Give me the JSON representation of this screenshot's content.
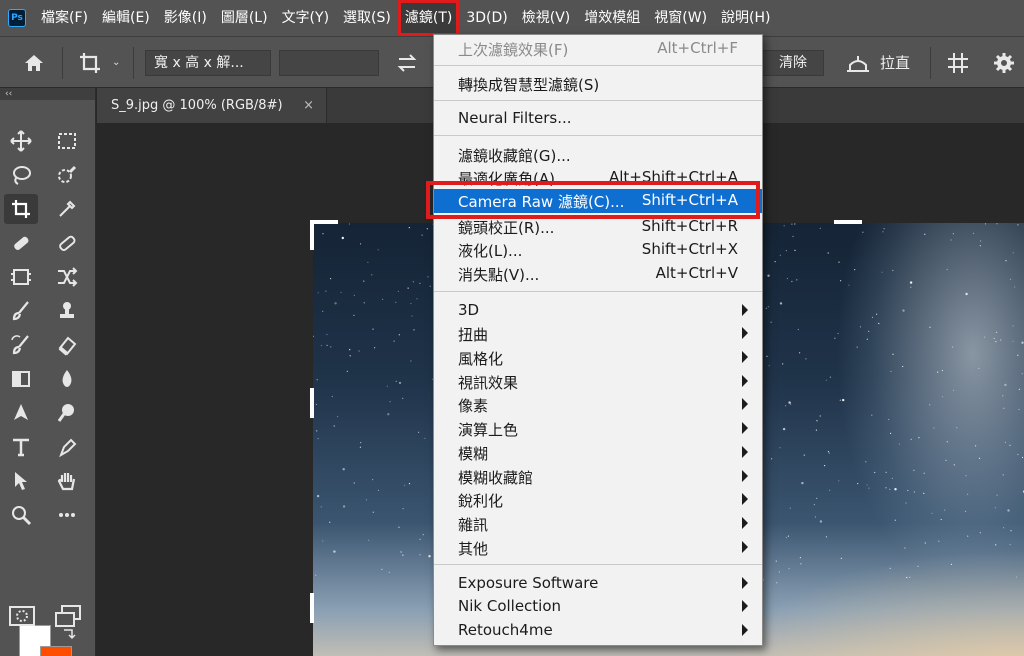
{
  "app": {
    "logo": "Ps"
  },
  "menubar": {
    "items": [
      "檔案(F)",
      "編輯(E)",
      "影像(I)",
      "圖層(L)",
      "文字(Y)",
      "選取(S)",
      "濾鏡(T)",
      "3D(D)",
      "檢視(V)",
      "增效模組",
      "視窗(W)",
      "說明(H)"
    ],
    "active_index": 6
  },
  "optionsbar": {
    "ratio_select": "寬 x 高 x 解...",
    "clear_label": "清除",
    "straighten_label": "拉直"
  },
  "toolpanel": {
    "collapse_glyph": "‹‹",
    "foreground_color": "#ffffff",
    "background_color": "#ff4d00"
  },
  "document": {
    "tab_title": "S_9.jpg @ 100% (RGB/8#)",
    "close_glyph": "×"
  },
  "filter_menu": {
    "items": [
      {
        "label": "上次濾鏡效果(F)",
        "shortcut": "Alt+Ctrl+F"
      },
      {
        "label": "轉換成智慧型濾鏡(S)",
        "shortcut": ""
      },
      {
        "label": "Neural Filters...",
        "shortcut": ""
      },
      {
        "label": "濾鏡收藏館(G)...",
        "shortcut": ""
      },
      {
        "label": "最適化廣角(A)...",
        "shortcut": "Alt+Shift+Ctrl+A"
      },
      {
        "label": "Camera Raw 濾鏡(C)...",
        "shortcut": "Shift+Ctrl+A"
      },
      {
        "label": "鏡頭校正(R)...",
        "shortcut": "Shift+Ctrl+R"
      },
      {
        "label": "液化(L)...",
        "shortcut": "Shift+Ctrl+X"
      },
      {
        "label": "消失點(V)...",
        "shortcut": "Alt+Ctrl+V"
      },
      {
        "label": "3D",
        "shortcut": ""
      },
      {
        "label": "扭曲",
        "shortcut": ""
      },
      {
        "label": "風格化",
        "shortcut": ""
      },
      {
        "label": "視訊效果",
        "shortcut": ""
      },
      {
        "label": "像素",
        "shortcut": ""
      },
      {
        "label": "演算上色",
        "shortcut": ""
      },
      {
        "label": "模糊",
        "shortcut": ""
      },
      {
        "label": "模糊收藏館",
        "shortcut": ""
      },
      {
        "label": "銳利化",
        "shortcut": ""
      },
      {
        "label": "雜訊",
        "shortcut": ""
      },
      {
        "label": "其他",
        "shortcut": ""
      },
      {
        "label": "Exposure Software",
        "shortcut": ""
      },
      {
        "label": "Nik Collection",
        "shortcut": ""
      },
      {
        "label": "Retouch4me",
        "shortcut": ""
      }
    ],
    "highlight_color": "#0f6fd0",
    "annotation_color": "#e01b1b"
  }
}
